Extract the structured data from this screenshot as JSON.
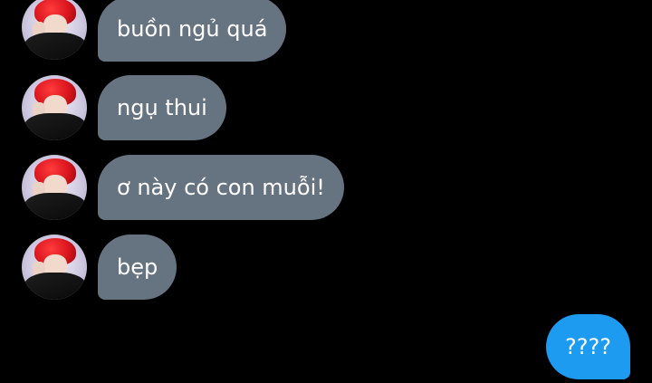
{
  "conversation": {
    "received_messages": [
      {
        "text": "buồn ngủ quá",
        "avatar_icon": "profile-avatar-red-hair"
      },
      {
        "text": "ngụ thui",
        "avatar_icon": "profile-avatar-red-hair"
      },
      {
        "text": "ơ này có con muỗi!",
        "avatar_icon": "profile-avatar-red-hair"
      },
      {
        "text": "bẹp",
        "avatar_icon": "profile-avatar-red-hair"
      }
    ],
    "sent_messages": [
      {
        "text": "????"
      }
    ]
  },
  "colors": {
    "background": "#000000",
    "received_bubble": "#667380",
    "sent_bubble": "#1d9bf0",
    "text": "#ffffff"
  }
}
